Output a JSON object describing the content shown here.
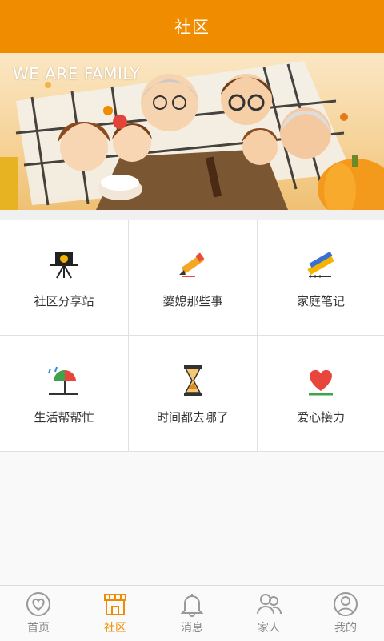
{
  "header": {
    "title": "社区"
  },
  "banner": {
    "text": "WE ARE FAMILY"
  },
  "grid": [
    {
      "label": "社区分享站",
      "icon": "projector-icon"
    },
    {
      "label": "婆媳那些事",
      "icon": "pencil-icon"
    },
    {
      "label": "家庭笔记",
      "icon": "ruler-pen-icon"
    },
    {
      "label": "生活帮帮忙",
      "icon": "umbrella-rain-icon"
    },
    {
      "label": "时间都去哪了",
      "icon": "hourglass-icon"
    },
    {
      "label": "爱心接力",
      "icon": "heart-icon"
    }
  ],
  "tabs": [
    {
      "label": "首页",
      "icon": "heart-circle-icon",
      "active": false
    },
    {
      "label": "社区",
      "icon": "shop-icon",
      "active": true
    },
    {
      "label": "消息",
      "icon": "bell-icon",
      "active": false
    },
    {
      "label": "家人",
      "icon": "people-icon",
      "active": false
    },
    {
      "label": "我的",
      "icon": "user-circle-icon",
      "active": false
    }
  ],
  "colors": {
    "accent": "#f08c00",
    "tab_inactive": "#888888"
  }
}
